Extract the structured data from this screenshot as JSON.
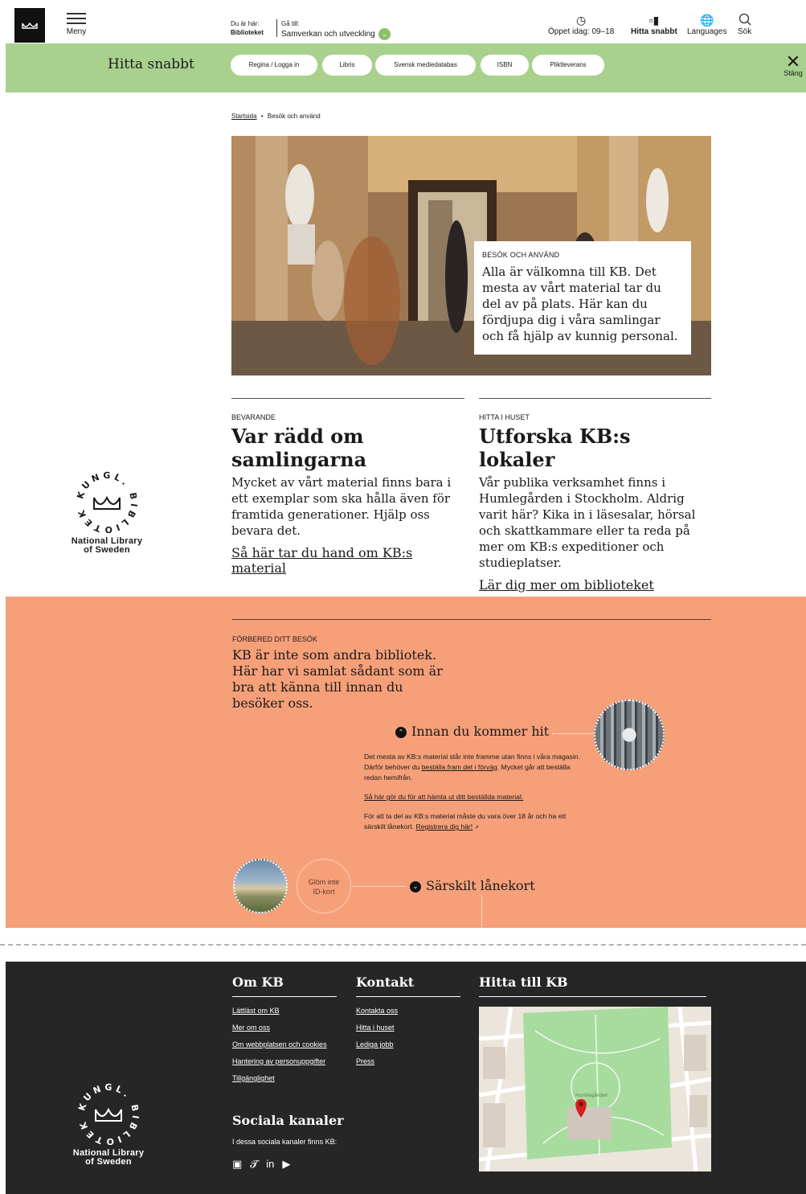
{
  "header": {
    "menu_label": "Meny",
    "crumb_here_label": "Du är här:",
    "crumb_here_value": "Biblioteket",
    "crumb_goto_label": "Gå till:",
    "crumb_goto_value": "Samverkan och utveckling",
    "open_today": "Öppet idag: 09–18",
    "quick_find": "Hitta snabbt",
    "languages": "Languages",
    "search": "Sök"
  },
  "quickbar": {
    "title": "Hitta snabbt",
    "links": [
      "Regina / Logga in",
      "Libris",
      "Svensk mediedatabas",
      "ISBN",
      "Pliktleverans"
    ],
    "close_label": "Stäng"
  },
  "breadcrumb": {
    "home": "Startsida",
    "separator": "•",
    "current": "Besök och använd"
  },
  "hero": {
    "kicker": "BESÖK OCH ANVÄND",
    "text": "Alla är välkomna till KB. Det mesta av vårt material tar du del av på plats. Här kan du fördjupa dig i våra samlingar och få hjälp av kunnig personal."
  },
  "articles": [
    {
      "kicker": "BEVARANDE",
      "title": "Var rädd om samlingarna",
      "body": "Mycket av vårt material finns bara i ett exemplar som ska hålla även för framtida generationer. Hjälp oss bevara det.",
      "link": "Så här tar du hand om KB:s material"
    },
    {
      "kicker": "HITTA I HUSET",
      "title": "Utforska KB:s lokaler",
      "body": "Vår publika verksamhet finns i Humlegården i Stockholm. Aldrig varit här? Kika in i läsesalar, hörsal och skattkammare eller ta reda på mer om KB:s expeditioner och studieplatser.",
      "link": "Lär dig mer om biblioteket"
    }
  ],
  "logo": {
    "arc_text": "KUNGL. BIBLIOTEKET",
    "name_line1": "National Library",
    "name_line2": "of Sweden"
  },
  "prepare": {
    "kicker": "FÖRBERED DITT BESÖK",
    "text": "KB är inte som andra bibliotek. Här har vi samlat sådant som är bra att känna till innan du besöker oss.",
    "innan_title": "Innan du kommer hit",
    "innan_p1_a": "Det mesta av KB:s material står inte framme utan finns i våra magasin. Därför behöver du ",
    "innan_p1_link": "beställa fram det i förväg",
    "innan_p1_b": ". Mycket går att beställa redan hemifrån.",
    "innan_p2_link": "Så här gör du för att hämta ut ditt beställda material.",
    "innan_p3_a": "För att ta del av KB:s material måste du vara över 18 år och ha ett särskilt lånekort. ",
    "innan_p3_link": "Registrera dig här!",
    "glom_line1": "Glöm inte",
    "glom_line2": "ID-kort",
    "sarskilt_title": "Särskilt lånekort"
  },
  "footer": {
    "om_kb": {
      "title": "Om KB",
      "links": [
        "Lättläst om KB",
        "Mer om oss",
        "Om webbplatsen och cookies",
        "Hantering av personuppgifter",
        "Tillgänglighet"
      ]
    },
    "kontakt": {
      "title": "Kontakt",
      "links": [
        "Kontakta oss",
        "Hitta i huset",
        "Lediga jobb",
        "Press"
      ]
    },
    "hitta": {
      "title": "Hitta till KB",
      "map_label": "Humlegården"
    },
    "social": {
      "title": "Sociala kanaler",
      "text": "I dessa sociala kanaler finns KB:",
      "icons": [
        "facebook-icon",
        "twitter-icon",
        "linkedin-icon",
        "youtube-icon"
      ]
    }
  },
  "colors": {
    "green": "#a9d18e",
    "orange": "#f6a07a",
    "footer": "#262626"
  }
}
